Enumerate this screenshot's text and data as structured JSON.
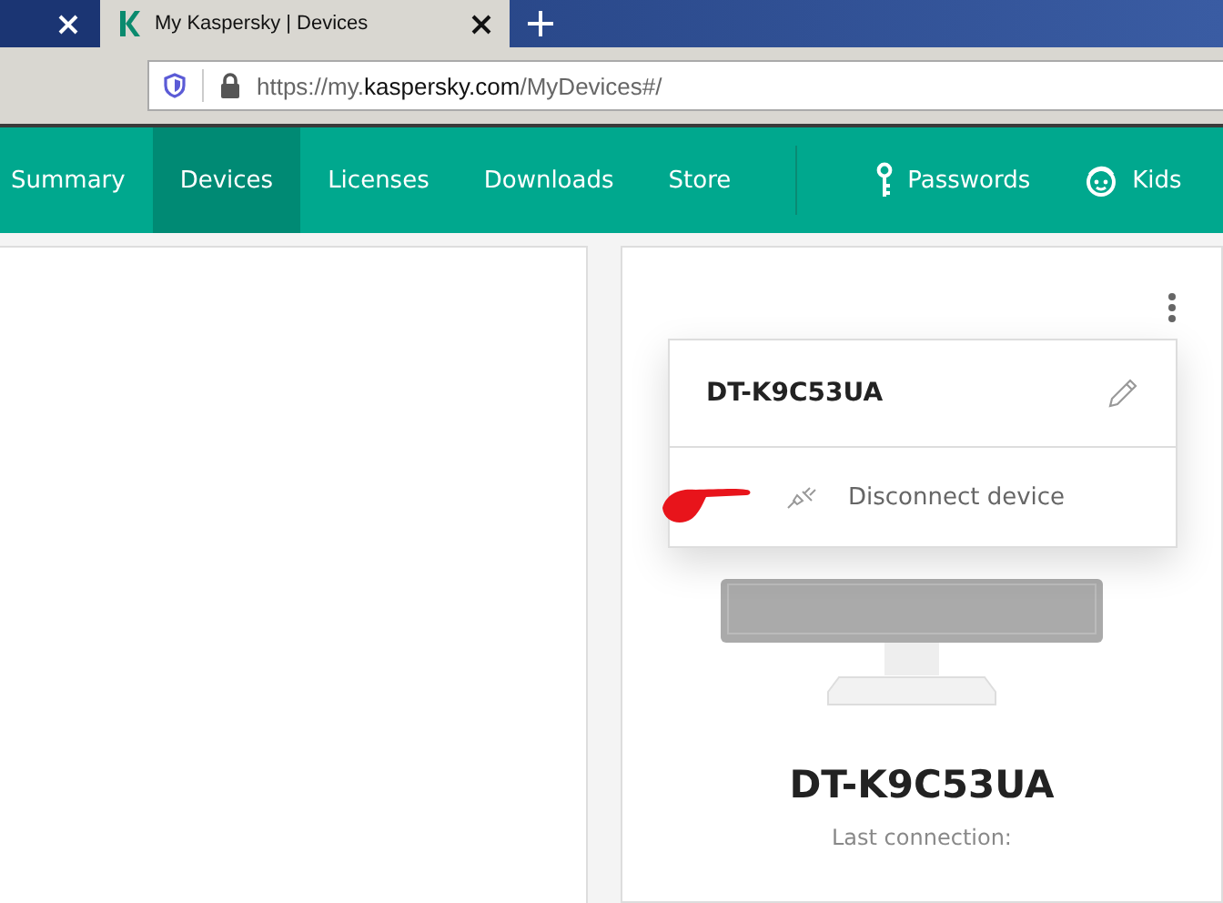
{
  "browser_tabs": [
    {
      "selected": false
    },
    {
      "title": "My Kaspersky | Devices",
      "selected": true
    }
  ],
  "address_bar": {
    "url_parts": [
      {
        "text": "https://my.",
        "emphasis": false
      },
      {
        "text": "kaspersky.com",
        "emphasis": true
      },
      {
        "text": "/MyDevices#/",
        "emphasis": false
      }
    ]
  },
  "nav": {
    "items": [
      {
        "label": "Summary",
        "selected": false
      },
      {
        "label": "Devices",
        "selected": true
      },
      {
        "label": "Licenses",
        "selected": false
      },
      {
        "label": "Downloads",
        "selected": false
      },
      {
        "label": "Store",
        "selected": false
      }
    ],
    "right_items": [
      {
        "label": "Passwords",
        "selected": false
      },
      {
        "label": "Kids",
        "selected": false
      }
    ]
  },
  "device_card": {
    "name": "DT-K9C53UA",
    "last_connection_label": "Last connection:",
    "menu": {
      "title": "DT-K9C53UA",
      "items": [
        {
          "label": "Disconnect device"
        }
      ]
    }
  }
}
